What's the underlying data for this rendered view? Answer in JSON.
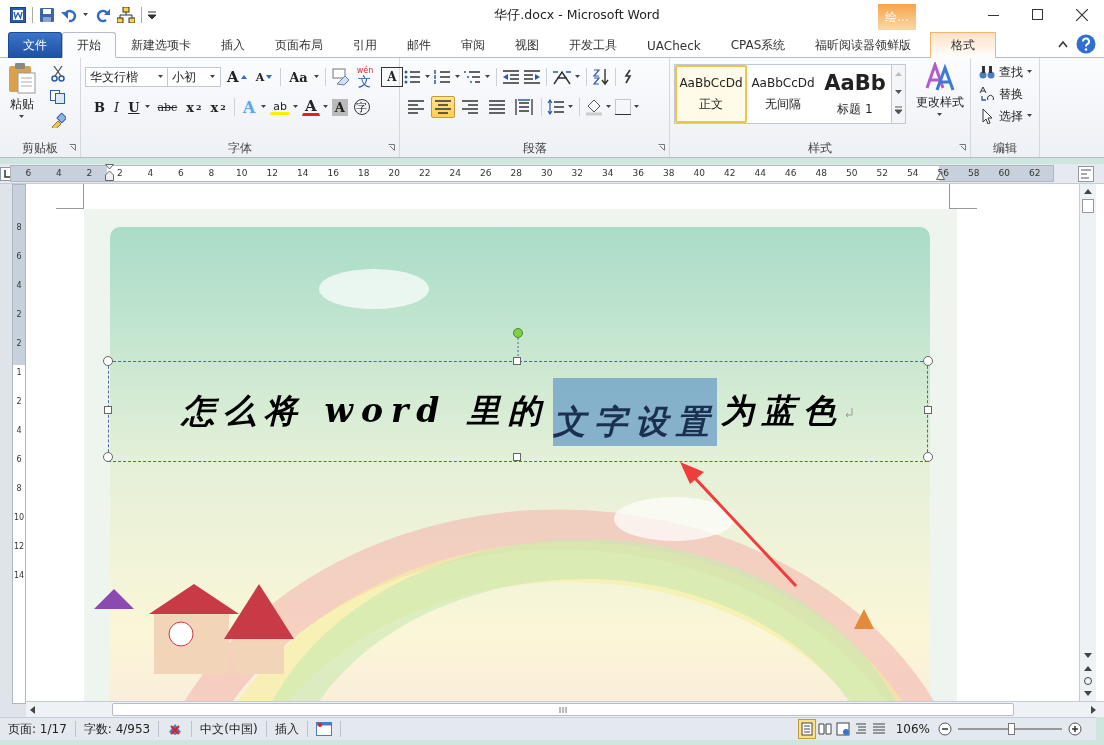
{
  "window": {
    "title": "华仔.docx - Microsoft Word"
  },
  "contextual_group": {
    "label": "绘..."
  },
  "tabs": [
    {
      "label": "文件",
      "kind": "file",
      "selected": false
    },
    {
      "label": "开始",
      "kind": "normal",
      "selected": true
    },
    {
      "label": "新建选项卡",
      "kind": "normal",
      "selected": false
    },
    {
      "label": "插入",
      "kind": "normal",
      "selected": false
    },
    {
      "label": "页面布局",
      "kind": "normal",
      "selected": false
    },
    {
      "label": "引用",
      "kind": "normal",
      "selected": false
    },
    {
      "label": "邮件",
      "kind": "normal",
      "selected": false
    },
    {
      "label": "审阅",
      "kind": "normal",
      "selected": false
    },
    {
      "label": "视图",
      "kind": "normal",
      "selected": false
    },
    {
      "label": "开发工具",
      "kind": "normal",
      "selected": false
    },
    {
      "label": "UACheck",
      "kind": "normal",
      "selected": false
    },
    {
      "label": "CPAS系统",
      "kind": "normal",
      "selected": false
    },
    {
      "label": "福昕阅读器领鲜版",
      "kind": "normal",
      "selected": false
    },
    {
      "label": "格式",
      "kind": "contextual",
      "selected": false
    }
  ],
  "ribbon": {
    "clipboard": {
      "paste": "粘贴",
      "label": "剪贴板"
    },
    "font": {
      "font_name": "华文行楷",
      "font_size": "小初",
      "label": "字体",
      "row1": [
        {
          "kind": "grow",
          "glyph": "A"
        },
        {
          "kind": "shrink",
          "glyph": "A"
        },
        {
          "kind": "case",
          "glyph": "Aa"
        },
        {
          "kind": "phonetic",
          "glyph": "文",
          "ruby": "wén"
        },
        {
          "kind": "border",
          "glyph": "A"
        }
      ],
      "row2": [
        {
          "kind": "bold",
          "glyph": "B"
        },
        {
          "kind": "italic",
          "glyph": "I"
        },
        {
          "kind": "underline",
          "glyph": "U"
        },
        {
          "kind": "strike",
          "glyph": "abc"
        },
        {
          "kind": "sub",
          "glyph": "x",
          "index": "2"
        },
        {
          "kind": "sup",
          "glyph": "x",
          "index": "2"
        },
        {
          "kind": "effects",
          "glyph": "A"
        },
        {
          "kind": "highlight",
          "glyph": "ab"
        },
        {
          "kind": "color",
          "glyph": "A"
        },
        {
          "kind": "shading",
          "glyph": "A"
        },
        {
          "kind": "enclose",
          "glyph": "字"
        }
      ]
    },
    "paragraph": {
      "label": "段落",
      "alignments": [
        {
          "selected": false
        },
        {
          "selected": true
        },
        {
          "selected": false
        },
        {
          "selected": false
        },
        {
          "selected": false
        }
      ]
    },
    "styles": {
      "label": "样式",
      "change_styles": "更改样式",
      "items": [
        {
          "preview": "AaBbCcDd",
          "name": "正文",
          "kind": "normal",
          "selected": true
        },
        {
          "preview": "AaBbCcDd",
          "name": "无间隔",
          "kind": "normal",
          "selected": false
        },
        {
          "preview": "AaBb",
          "name": "标题 1",
          "kind": "heading",
          "selected": false
        }
      ]
    },
    "editing": {
      "label": "编辑",
      "items": [
        {
          "label": "查找",
          "kind": "find"
        },
        {
          "label": "替换",
          "kind": "replace"
        },
        {
          "label": "选择",
          "kind": "select"
        }
      ]
    }
  },
  "ruler": {
    "labels": [
      "6",
      "4",
      "2",
      "2",
      "4",
      "6",
      "8",
      "10",
      "12",
      "14",
      "16",
      "18",
      "20",
      "22",
      "24",
      "26",
      "28",
      "30",
      "32",
      "34",
      "36",
      "38",
      "40",
      "42",
      "44",
      "46",
      "48",
      "50",
      "52",
      "54",
      "56",
      "58",
      "60",
      "62"
    ],
    "vertical_labels": [
      "8",
      "6",
      "4",
      "2",
      "2",
      "1",
      "2",
      "4",
      "6",
      "8",
      "10",
      "12",
      "14"
    ]
  },
  "document": {
    "heading": [
      {
        "text": "怎么将 word 里的",
        "selected": false
      },
      {
        "text": "文字设置",
        "selected": true
      },
      {
        "text": "为蓝色",
        "selected": false
      }
    ]
  },
  "status_bar": {
    "page": "页面: 1/17",
    "words": "字数: 4/953",
    "language": "中文(中国)",
    "mode": "插入",
    "views": [
      {
        "selected": true
      },
      {
        "selected": false
      },
      {
        "selected": false
      },
      {
        "selected": false
      },
      {
        "selected": false
      }
    ],
    "zoom": "106%",
    "zoom_slider": {
      "level": 0.51
    }
  }
}
